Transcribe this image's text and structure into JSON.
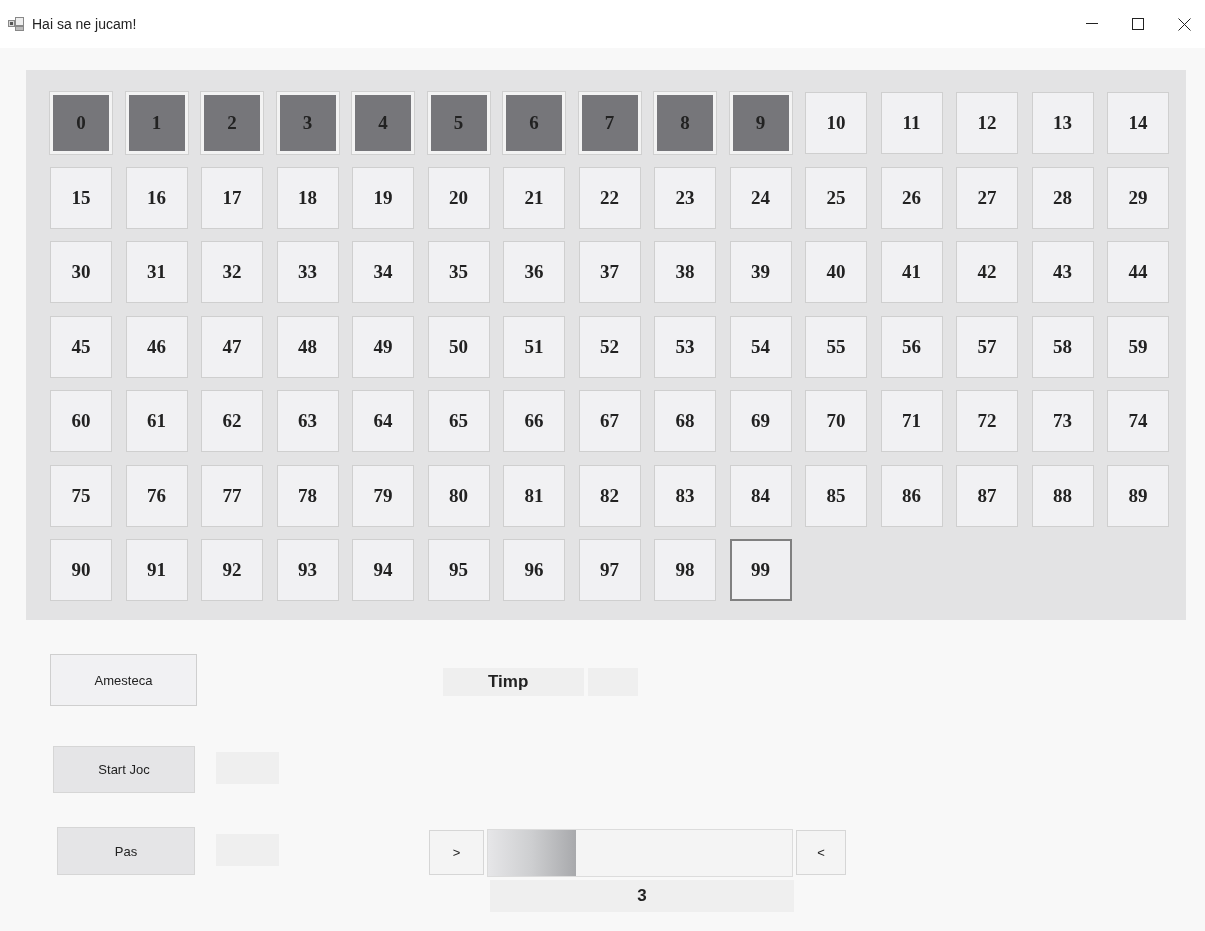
{
  "window": {
    "title": "Hai sa ne jucam!"
  },
  "board": {
    "cells": [
      {
        "label": "0",
        "marked": true,
        "focused": false
      },
      {
        "label": "1",
        "marked": true,
        "focused": false
      },
      {
        "label": "2",
        "marked": true,
        "focused": false
      },
      {
        "label": "3",
        "marked": true,
        "focused": false
      },
      {
        "label": "4",
        "marked": true,
        "focused": false
      },
      {
        "label": "5",
        "marked": true,
        "focused": false
      },
      {
        "label": "6",
        "marked": true,
        "focused": false
      },
      {
        "label": "7",
        "marked": true,
        "focused": false
      },
      {
        "label": "8",
        "marked": true,
        "focused": false
      },
      {
        "label": "9",
        "marked": true,
        "focused": false
      },
      {
        "label": "10",
        "marked": false,
        "focused": false
      },
      {
        "label": "11",
        "marked": false,
        "focused": false
      },
      {
        "label": "12",
        "marked": false,
        "focused": false
      },
      {
        "label": "13",
        "marked": false,
        "focused": false
      },
      {
        "label": "14",
        "marked": false,
        "focused": false
      },
      {
        "label": "15",
        "marked": false,
        "focused": false
      },
      {
        "label": "16",
        "marked": false,
        "focused": false
      },
      {
        "label": "17",
        "marked": false,
        "focused": false
      },
      {
        "label": "18",
        "marked": false,
        "focused": false
      },
      {
        "label": "19",
        "marked": false,
        "focused": false
      },
      {
        "label": "20",
        "marked": false,
        "focused": false
      },
      {
        "label": "21",
        "marked": false,
        "focused": false
      },
      {
        "label": "22",
        "marked": false,
        "focused": false
      },
      {
        "label": "23",
        "marked": false,
        "focused": false
      },
      {
        "label": "24",
        "marked": false,
        "focused": false
      },
      {
        "label": "25",
        "marked": false,
        "focused": false
      },
      {
        "label": "26",
        "marked": false,
        "focused": false
      },
      {
        "label": "27",
        "marked": false,
        "focused": false
      },
      {
        "label": "28",
        "marked": false,
        "focused": false
      },
      {
        "label": "29",
        "marked": false,
        "focused": false
      },
      {
        "label": "30",
        "marked": false,
        "focused": false
      },
      {
        "label": "31",
        "marked": false,
        "focused": false
      },
      {
        "label": "32",
        "marked": false,
        "focused": false
      },
      {
        "label": "33",
        "marked": false,
        "focused": false
      },
      {
        "label": "34",
        "marked": false,
        "focused": false
      },
      {
        "label": "35",
        "marked": false,
        "focused": false
      },
      {
        "label": "36",
        "marked": false,
        "focused": false
      },
      {
        "label": "37",
        "marked": false,
        "focused": false
      },
      {
        "label": "38",
        "marked": false,
        "focused": false
      },
      {
        "label": "39",
        "marked": false,
        "focused": false
      },
      {
        "label": "40",
        "marked": false,
        "focused": false
      },
      {
        "label": "41",
        "marked": false,
        "focused": false
      },
      {
        "label": "42",
        "marked": false,
        "focused": false
      },
      {
        "label": "43",
        "marked": false,
        "focused": false
      },
      {
        "label": "44",
        "marked": false,
        "focused": false
      },
      {
        "label": "45",
        "marked": false,
        "focused": false
      },
      {
        "label": "46",
        "marked": false,
        "focused": false
      },
      {
        "label": "47",
        "marked": false,
        "focused": false
      },
      {
        "label": "48",
        "marked": false,
        "focused": false
      },
      {
        "label": "49",
        "marked": false,
        "focused": false
      },
      {
        "label": "50",
        "marked": false,
        "focused": false
      },
      {
        "label": "51",
        "marked": false,
        "focused": false
      },
      {
        "label": "52",
        "marked": false,
        "focused": false
      },
      {
        "label": "53",
        "marked": false,
        "focused": false
      },
      {
        "label": "54",
        "marked": false,
        "focused": false
      },
      {
        "label": "55",
        "marked": false,
        "focused": false
      },
      {
        "label": "56",
        "marked": false,
        "focused": false
      },
      {
        "label": "57",
        "marked": false,
        "focused": false
      },
      {
        "label": "58",
        "marked": false,
        "focused": false
      },
      {
        "label": "59",
        "marked": false,
        "focused": false
      },
      {
        "label": "60",
        "marked": false,
        "focused": false
      },
      {
        "label": "61",
        "marked": false,
        "focused": false
      },
      {
        "label": "62",
        "marked": false,
        "focused": false
      },
      {
        "label": "63",
        "marked": false,
        "focused": false
      },
      {
        "label": "64",
        "marked": false,
        "focused": false
      },
      {
        "label": "65",
        "marked": false,
        "focused": false
      },
      {
        "label": "66",
        "marked": false,
        "focused": false
      },
      {
        "label": "67",
        "marked": false,
        "focused": false
      },
      {
        "label": "68",
        "marked": false,
        "focused": false
      },
      {
        "label": "69",
        "marked": false,
        "focused": false
      },
      {
        "label": "70",
        "marked": false,
        "focused": false
      },
      {
        "label": "71",
        "marked": false,
        "focused": false
      },
      {
        "label": "72",
        "marked": false,
        "focused": false
      },
      {
        "label": "73",
        "marked": false,
        "focused": false
      },
      {
        "label": "74",
        "marked": false,
        "focused": false
      },
      {
        "label": "75",
        "marked": false,
        "focused": false
      },
      {
        "label": "76",
        "marked": false,
        "focused": false
      },
      {
        "label": "77",
        "marked": false,
        "focused": false
      },
      {
        "label": "78",
        "marked": false,
        "focused": false
      },
      {
        "label": "79",
        "marked": false,
        "focused": false
      },
      {
        "label": "80",
        "marked": false,
        "focused": false
      },
      {
        "label": "81",
        "marked": false,
        "focused": false
      },
      {
        "label": "82",
        "marked": false,
        "focused": false
      },
      {
        "label": "83",
        "marked": false,
        "focused": false
      },
      {
        "label": "84",
        "marked": false,
        "focused": false
      },
      {
        "label": "85",
        "marked": false,
        "focused": false
      },
      {
        "label": "86",
        "marked": false,
        "focused": false
      },
      {
        "label": "87",
        "marked": false,
        "focused": false
      },
      {
        "label": "88",
        "marked": false,
        "focused": false
      },
      {
        "label": "89",
        "marked": false,
        "focused": false
      },
      {
        "label": "90",
        "marked": false,
        "focused": false
      },
      {
        "label": "91",
        "marked": false,
        "focused": false
      },
      {
        "label": "92",
        "marked": false,
        "focused": false
      },
      {
        "label": "93",
        "marked": false,
        "focused": false
      },
      {
        "label": "94",
        "marked": false,
        "focused": false
      },
      {
        "label": "95",
        "marked": false,
        "focused": false
      },
      {
        "label": "96",
        "marked": false,
        "focused": false
      },
      {
        "label": "97",
        "marked": false,
        "focused": false
      },
      {
        "label": "98",
        "marked": false,
        "focused": false
      },
      {
        "label": "99",
        "marked": false,
        "focused": true
      }
    ]
  },
  "controls": {
    "shuffle_button": "Amesteca",
    "time_label": "Timp",
    "start_button": "Start Joc",
    "step_button": "Pas",
    "next_button": ">",
    "prev_button": "<",
    "progress": {
      "level": 0.29
    },
    "step_value": "3"
  }
}
